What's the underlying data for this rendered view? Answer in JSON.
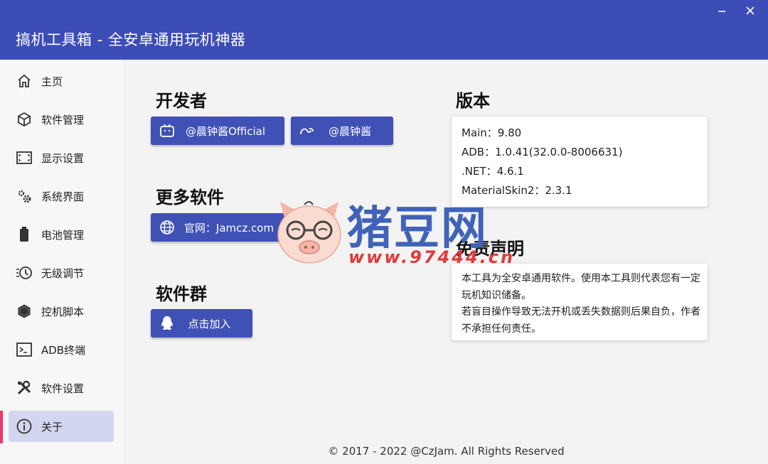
{
  "window": {
    "title": "搞机工具箱 - 全安卓通用玩机神器"
  },
  "sidebar": {
    "items": [
      {
        "label": "主页",
        "icon": "home-icon"
      },
      {
        "label": "软件管理",
        "icon": "cube-icon"
      },
      {
        "label": "显示设置",
        "icon": "display-icon"
      },
      {
        "label": "系统界面",
        "icon": "gears-icon"
      },
      {
        "label": "电池管理",
        "icon": "battery-icon"
      },
      {
        "label": "无级调节",
        "icon": "clock-adjust-icon"
      },
      {
        "label": "控机脚本",
        "icon": "hexagon-icon"
      },
      {
        "label": "ADB终端",
        "icon": "terminal-icon"
      },
      {
        "label": "软件设置",
        "icon": "tools-icon"
      },
      {
        "label": "关于",
        "icon": "info-icon"
      }
    ],
    "active_index": 9
  },
  "developer": {
    "title": "开发者",
    "bilibili_label": "@晨钟酱Official",
    "weibo_label": "@晨钟酱"
  },
  "more_software": {
    "title": "更多软件",
    "website_label": "官网：Jamcz.com"
  },
  "group": {
    "title": "软件群",
    "join_label": "点击加入"
  },
  "version": {
    "title": "版本",
    "main": "Main：9.80",
    "adb": "ADB：1.0.41(32.0.0-8006631)",
    "net": ".NET：4.6.1",
    "materialskin": "MaterialSkin2：2.3.1"
  },
  "disclaimer": {
    "title": "免责声明",
    "line1": "本工具为全安卓通用软件。使用本工具则代表您有一定玩机知识储备。",
    "line2": "若盲目操作导致无法开机或丢失数据则后果自负，作者不承担任何责任。"
  },
  "footer": {
    "copyright": "© 2017 - 2022 @CzJam. All Rights Reserved"
  },
  "watermark": {
    "text": "猪豆网",
    "url": "www.97444.cn"
  },
  "colors": {
    "primary": "#3f51b5",
    "titlebar": "#3d4db8",
    "active_bg": "#d3d6ef",
    "active_bar": "#e8386c"
  }
}
